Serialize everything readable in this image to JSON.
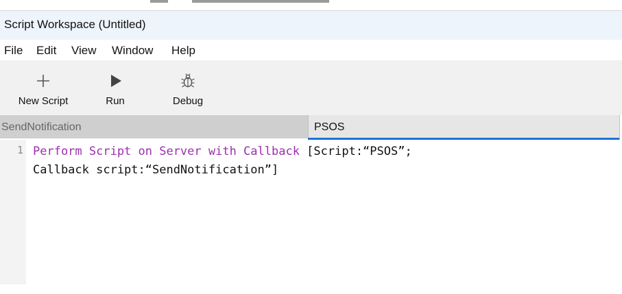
{
  "window": {
    "title": "Script Workspace (Untitled)"
  },
  "menu": {
    "items": [
      "File",
      "Edit",
      "View",
      "Window",
      "Help"
    ]
  },
  "toolbar": {
    "new_script": {
      "label": "New Script",
      "icon": "plus-icon"
    },
    "run": {
      "label": "Run",
      "icon": "play-icon"
    },
    "debug": {
      "label": "Debug",
      "icon": "bug-icon"
    }
  },
  "tabs": [
    {
      "label": "SendNotification",
      "active": false
    },
    {
      "label": "PSOS",
      "active": true
    }
  ],
  "editor": {
    "line_number": "1",
    "step_name": "Perform Script on Server with Callback",
    "line1_rest": " [Script:“PSOS”;",
    "line2": "Callback script:“SendNotification”]"
  },
  "colors": {
    "step_keyword": "#9b2fae",
    "active_tab_underline": "#1f73d6",
    "titlebar_bg": "#eef4fb",
    "toolbar_bg": "#f1f1f1"
  }
}
